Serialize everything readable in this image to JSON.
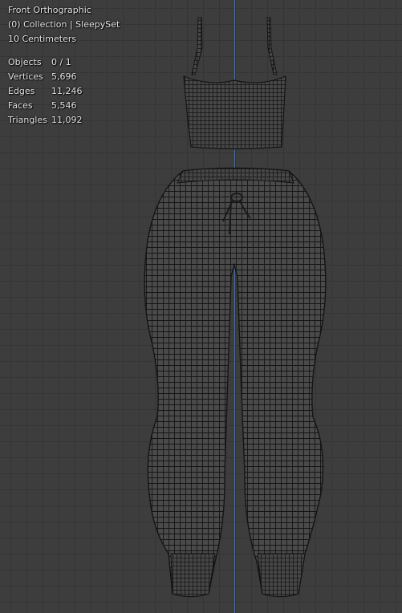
{
  "viewport": {
    "view_name": "Front Orthographic",
    "collection_line": "(0) Collection | SleepySet",
    "scale_line": "10 Centimeters",
    "grid_color": "#353535",
    "background_color": "#3d3d3d",
    "axis_color": "#4b6fa3"
  },
  "stats": [
    {
      "label": "Objects",
      "value": "0 / 1"
    },
    {
      "label": "Vertices",
      "value": "5,696"
    },
    {
      "label": "Edges",
      "value": "11,246"
    },
    {
      "label": "Faces",
      "value": "5,546"
    },
    {
      "label": "Triangles",
      "value": "11,092"
    }
  ],
  "mesh": {
    "object_name": "SleepySet",
    "wire_color": "#141414",
    "fill_color": "#4a4a4a"
  }
}
